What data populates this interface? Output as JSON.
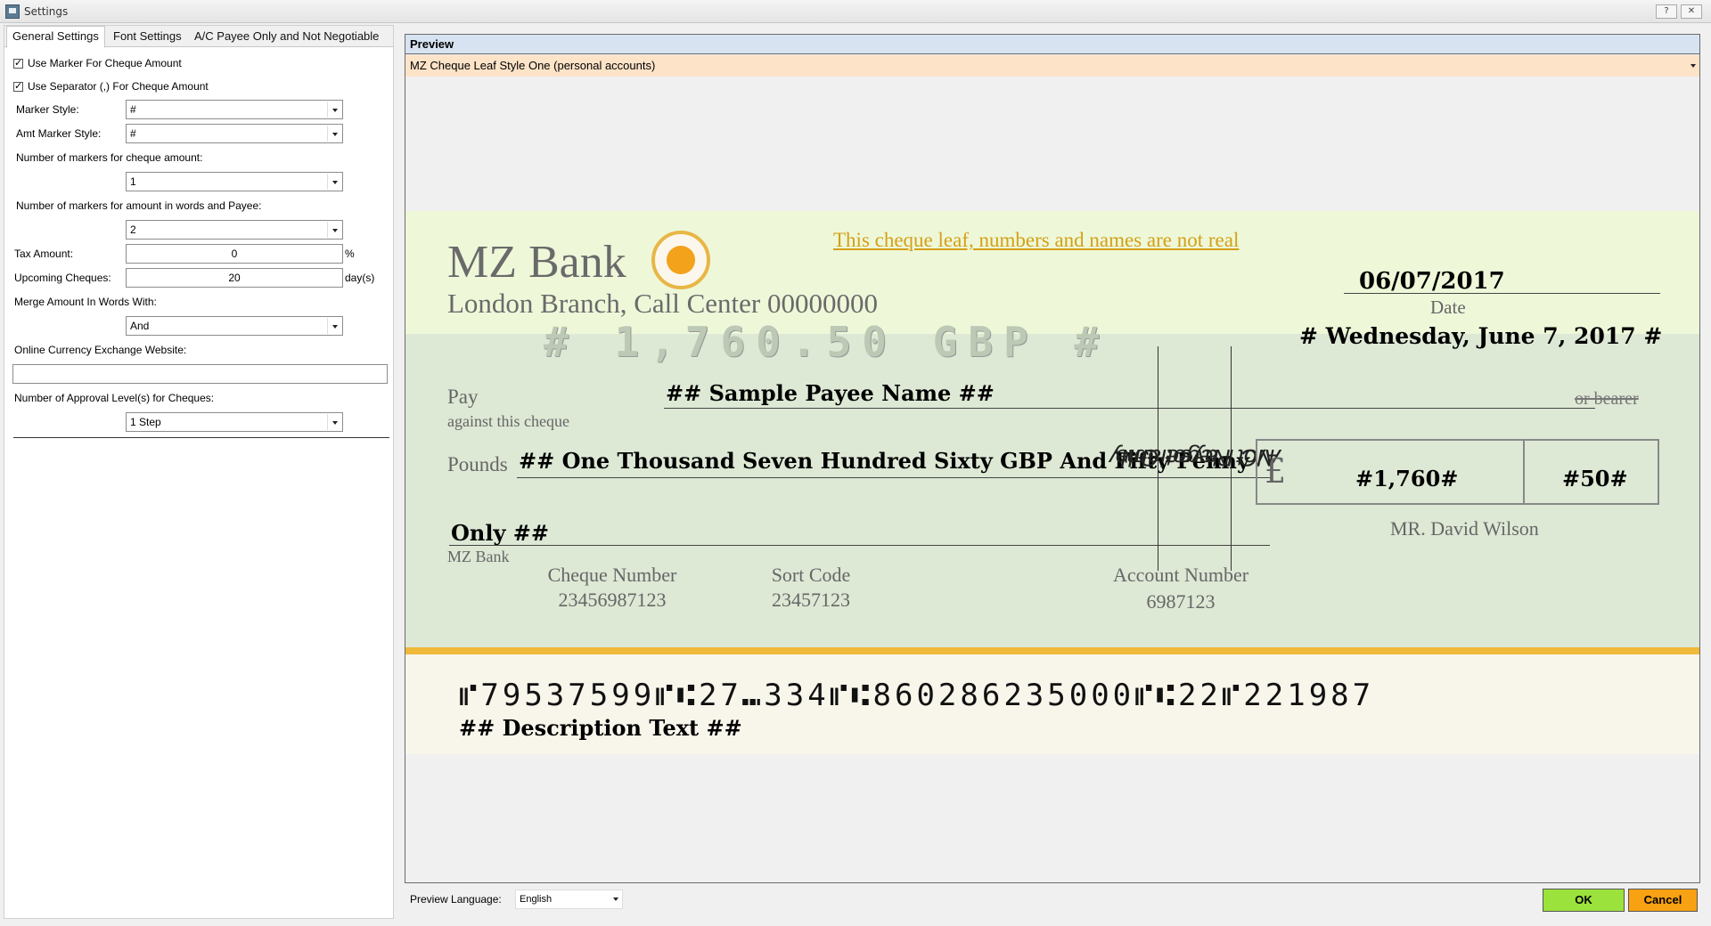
{
  "window": {
    "title": "Settings",
    "help_label": "?",
    "close_label": "✕"
  },
  "tabs": [
    "General Settings",
    "Font Settings",
    "A/C Payee Only and Not Negotiable"
  ],
  "general": {
    "use_marker_label": "Use Marker For Cheque Amount",
    "use_separator_label": "Use Separator (,) For Cheque Amount",
    "marker_style_label": "Marker Style:",
    "marker_style_value": "#",
    "amt_marker_style_label": "Amt Marker Style:",
    "amt_marker_style_value": "#",
    "num_markers_amount_label": "Number of markers for cheque amount:",
    "num_markers_amount_value": "1",
    "num_markers_words_label": "Number of markers for amount in words and Payee:",
    "num_markers_words_value": "2",
    "tax_amount_label": "Tax Amount:",
    "tax_amount_value": "0",
    "tax_unit": "%",
    "upcoming_cheques_label": "Upcoming Cheques:",
    "upcoming_cheques_value": "20",
    "upcoming_unit": "day(s)",
    "merge_label": "Merge Amount In Words With:",
    "merge_value": "And",
    "exchange_label": "Online Currency Exchange Website:",
    "exchange_value": "",
    "approval_label": "Number of Approval Level(s) for Cheques:",
    "approval_value": "1 Step"
  },
  "preview": {
    "header": "Preview",
    "style_value": "MZ Cheque Leaf Style One (personal accounts)",
    "language_label": "Preview Language:",
    "language_value": "English"
  },
  "cheque": {
    "bank_name": "MZ Bank",
    "branch": "London Branch, Call Center 00000000",
    "disclaimer": "This cheque leaf, numbers and names are not real",
    "date": "06/07/2017",
    "date_label": "Date",
    "amount_marker": "# 1,760.50 GBP #",
    "long_date": "# Wednesday, June 7, 2017 #",
    "pay_label": "Pay",
    "against_label": "against this cheque",
    "payee": "## Sample Payee Name ##",
    "bearer_label": "or bearer",
    "pounds_label": "Pounds",
    "amount_words": "## One Thousand Seven Hundred Sixty GBP And Fifty Penny",
    "only_text": "Only ##",
    "bank_signature": "MZ Bank",
    "crossing_line1": "Not Negotiable",
    "crossing_line2": "A/C Payee Only",
    "currency_symbol": "£",
    "amount_main": "#1,760#",
    "amount_minor": "#50#",
    "account_name": "MR. David Wilson",
    "cheque_number_label": "Cheque Number",
    "cheque_number": "23456987123",
    "sort_code_label": "Sort Code",
    "sort_code": "23457123",
    "account_number_label": "Account Number",
    "account_number": "6987123",
    "micr_line": "⑈79537599⑈⑆27⑉334⑈⑆860286235000⑈⑆22⑈221987",
    "description": "## Description Text ##"
  },
  "buttons": {
    "ok": "OK",
    "cancel": "Cancel"
  },
  "colors": {
    "ok": "#9be23c",
    "cancel": "#f8a112",
    "preview_header": "#d7e3f1",
    "style_select": "#fde3c8",
    "cheque_top": "#eef8d9",
    "cheque_mid": "#dde8d5",
    "gold_band": "#f0b93a"
  }
}
